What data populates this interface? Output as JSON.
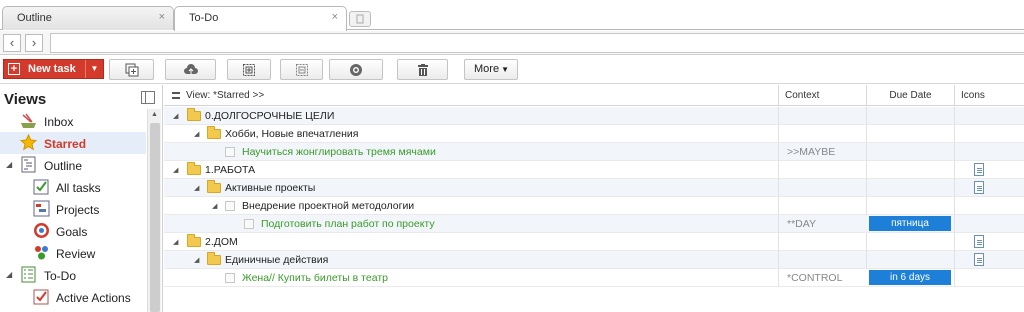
{
  "tabs": [
    {
      "label": "Outline",
      "close": "×"
    },
    {
      "label": "To-Do",
      "close": "×"
    }
  ],
  "nav": {
    "back": "‹",
    "forward": "›"
  },
  "toolbar": {
    "new_task": "New task",
    "more": "More"
  },
  "sidebar": {
    "title": "Views",
    "items": [
      {
        "label": "Inbox"
      },
      {
        "label": "Starred"
      },
      {
        "label": "Outline"
      },
      {
        "label": "All tasks"
      },
      {
        "label": "Projects"
      },
      {
        "label": "Goals"
      },
      {
        "label": "Review"
      },
      {
        "label": "To-Do"
      },
      {
        "label": "Active Actions"
      }
    ]
  },
  "list": {
    "view_label": "View: *Starred >>",
    "columns": {
      "context": "Context",
      "due": "Due Date",
      "icons": "Icons"
    },
    "rows": [
      {
        "text": "0.ДОЛГОСРОЧНЫЕ ЦЕЛИ",
        "context": "",
        "due": ""
      },
      {
        "text": "Хобби, Новые впечатления",
        "context": "",
        "due": ""
      },
      {
        "text": "Научиться жонглировать тремя мячами",
        "context": ">>MAYBE",
        "due": ""
      },
      {
        "text": "1.РАБОТА",
        "context": "",
        "due": ""
      },
      {
        "text": "Активные проекты",
        "context": "",
        "due": ""
      },
      {
        "text": "Внедрение проектной методологии",
        "context": "",
        "due": ""
      },
      {
        "text": "Подготовить план работ по проекту",
        "context": "**DAY",
        "due": "пятница"
      },
      {
        "text": "2.ДОМ",
        "context": "",
        "due": ""
      },
      {
        "text": "Единичные действия",
        "context": "",
        "due": ""
      },
      {
        "text": "Жена// Купить билеты в театр",
        "context": "*CONTROL",
        "due": "in 6 days"
      }
    ]
  },
  "colors": {
    "accent": "#d33a2c",
    "due_badge": "#1e7fd8",
    "task_text": "#3a9a2a"
  }
}
